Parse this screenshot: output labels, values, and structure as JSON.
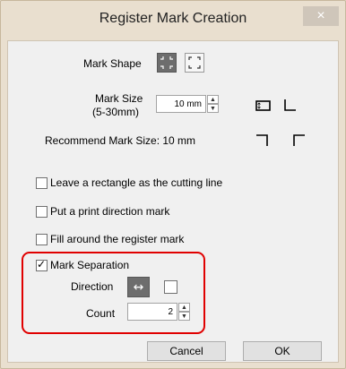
{
  "window": {
    "title": "Register Mark Creation",
    "close_glyph": "×"
  },
  "mark_shape": {
    "label": "Mark Shape",
    "buttons": [
      {
        "icon": "corner-marks-icon",
        "selected": true
      },
      {
        "icon": "corner-marks-outline-icon",
        "selected": false
      }
    ]
  },
  "mark_size": {
    "label_line1": "Mark Size",
    "label_line2": "(5-30mm)",
    "value": "10 mm"
  },
  "recommend": {
    "text": "Recommend Mark Size:  10 mm"
  },
  "options": [
    {
      "label": "Leave a rectangle as the cutting line",
      "checked": false
    },
    {
      "label": "Put a print direction mark",
      "checked": false
    },
    {
      "label": "Fill around the register mark",
      "checked": false
    }
  ],
  "separation": {
    "label": "Mark Separation",
    "checked": true,
    "direction_label": "Direction",
    "direction_glyph": "↔",
    "direction_checkbox_checked": false,
    "count_label": "Count",
    "count_value": "2"
  },
  "buttons": {
    "cancel": "Cancel",
    "ok": "OK"
  },
  "colors": {
    "highlight": "#e00000",
    "title_bar": "#e9dfcf",
    "client_bg": "#f0f0f0"
  }
}
